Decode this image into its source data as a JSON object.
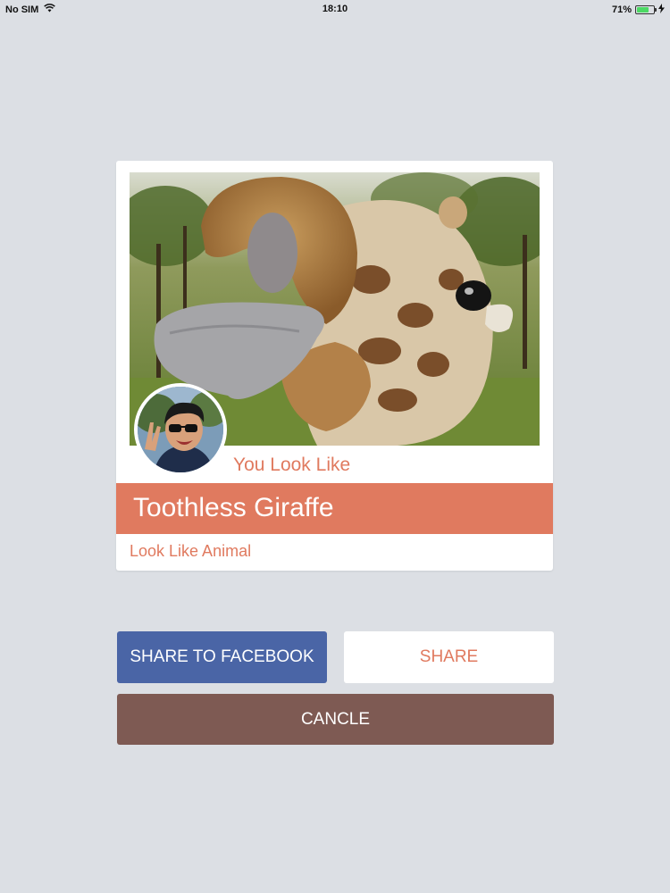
{
  "status_bar": {
    "carrier": "No SIM",
    "time": "18:10",
    "battery_percent": "71%",
    "battery_level": 0.71,
    "icons": [
      "wifi-icon",
      "battery-icon",
      "charging-icon"
    ]
  },
  "result_card": {
    "photo_subject": "giraffe-photo",
    "avatar": "user-avatar",
    "prompt": "You Look Like",
    "result_name": "Toothless Giraffe",
    "caption": "Look Like Animal"
  },
  "actions": {
    "facebook_label": "SHARE TO FACEBOOK",
    "share_label": "SHARE",
    "cancel_label": "CANCLE"
  },
  "colors": {
    "background": "#dcdfe4",
    "accent": "#e07a5f",
    "facebook": "#4a65a6",
    "cancel": "#7e5a53",
    "card": "#ffffff"
  }
}
